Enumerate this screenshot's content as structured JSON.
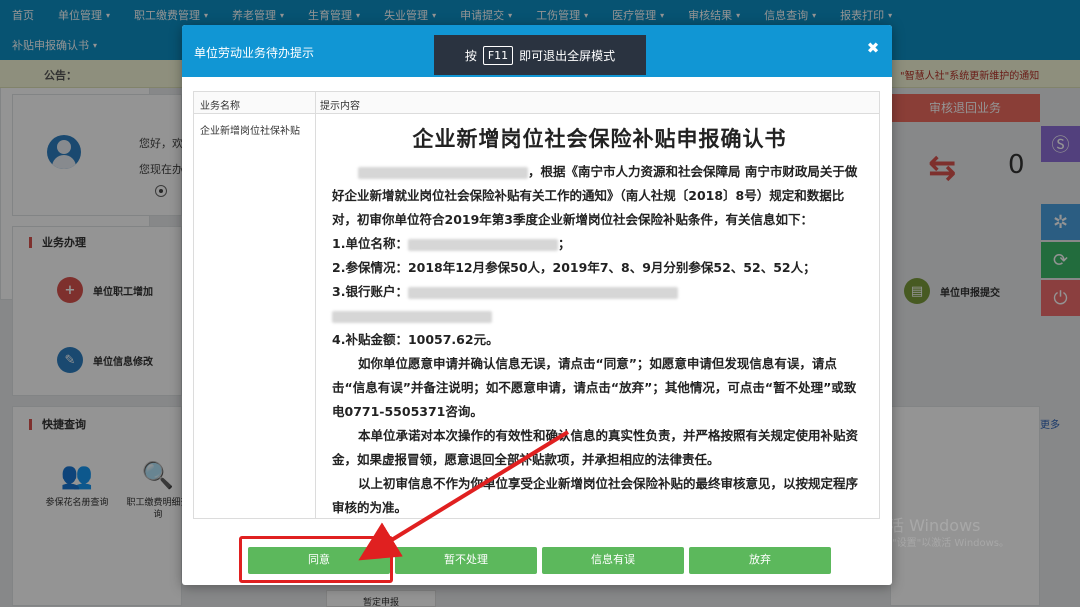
{
  "nav": {
    "row1": [
      "首页",
      "单位管理",
      "职工缴费管理",
      "养老管理",
      "生育管理",
      "失业管理",
      "申请提交",
      "工伤管理",
      "医疗管理",
      "审核结果",
      "信息查询",
      "报表打印"
    ],
    "row1_has_caret": [
      false,
      true,
      true,
      true,
      true,
      true,
      true,
      true,
      true,
      true,
      true,
      true
    ],
    "row2": [
      "补贴申报确认书"
    ]
  },
  "announcement": {
    "label": "公告：",
    "text": "\"智慧人社\"系统更新维护的通知"
  },
  "user_panel": {
    "greeting": "您好，欢",
    "now_text": "您现在办"
  },
  "business": {
    "title": "业务办理",
    "items": [
      {
        "label": "单位职工增加",
        "icon": "add-user-icon",
        "color": "#d9534f"
      },
      {
        "label": "单位信息修改",
        "icon": "edit-info-icon",
        "color": "#2d7fc1"
      },
      {
        "label": "单位申报提交",
        "icon": "document-icon",
        "color": "#7a9c3b"
      }
    ]
  },
  "quick_query": {
    "title": "快捷查询",
    "items": [
      {
        "label": "参保花名册查询",
        "icon": "people-icon"
      },
      {
        "label": "职工缴费明细查询",
        "icon": "magnify-money-icon"
      }
    ],
    "more": "更多"
  },
  "right_panel": {
    "return_button": "审核退回业务",
    "return_count": "0"
  },
  "bottom_tab": "暂定申报",
  "windows_watermark": {
    "title": "激活 Windows",
    "subtitle": "转到\"设置\"以激活 Windows。"
  },
  "modal": {
    "title": "单位劳动业务待办提示",
    "fullscreen_hint_pre": "按",
    "fullscreen_key": "F11",
    "fullscreen_hint_post": "即可退出全屏模式",
    "table_headers": {
      "name": "业务名称",
      "content": "提示内容"
    },
    "business_name": "企业新增岗位社保补贴",
    "doc_title": "企业新增岗位社会保险补贴申报确认书",
    "intro": "，根据《南宁市人力资源和社会保障局 南宁市财政局关于做好企业新增就业岗位社会保险补贴有关工作的通知》（南人社规〔2018〕8号）规定和数据比对，初审你单位符合2019年第3季度企业新增岗位社会保险补贴条件，有关信息如下：",
    "items": {
      "unit_name": "1.单位名称：",
      "unit_name_end": "；",
      "insurance": "2.参保情况：2018年12月参保50人，2019年7、8、9月分别参保52、52、52人；",
      "bank": "3.银行账户：",
      "amount": "4.补贴金额：10057.62元。"
    },
    "para_confirm": "如你单位愿意申请并确认信息无误，请点击“同意”；如愿意申请但发现信息有误，请点击“信息有误”并备注说明；如不愿意申请，请点击“放弃”；其他情况，可点击“暂不处理”或致电0771-5505371咨询。",
    "para_promise": "本单位承诺对本次操作的有效性和确认信息的真实性负责，并严格按照有关规定使用补贴资金，如果虚报冒领，愿意退回全部补贴款项，并承担相应的法律责任。",
    "para_note": "以上初审信息不作为你单位享受企业新增岗位社会保险补贴的最终审核意见，以按规定程序审核的为准。",
    "buttons": {
      "agree": "同意",
      "defer": "暂不处理",
      "error": "信息有误",
      "abandon": "放弃"
    }
  },
  "colors": {
    "nav_blue": "#0d8fc4",
    "modal_header": "#1196d4",
    "button_green": "#5cb85c",
    "annotation_red": "#e02020"
  }
}
